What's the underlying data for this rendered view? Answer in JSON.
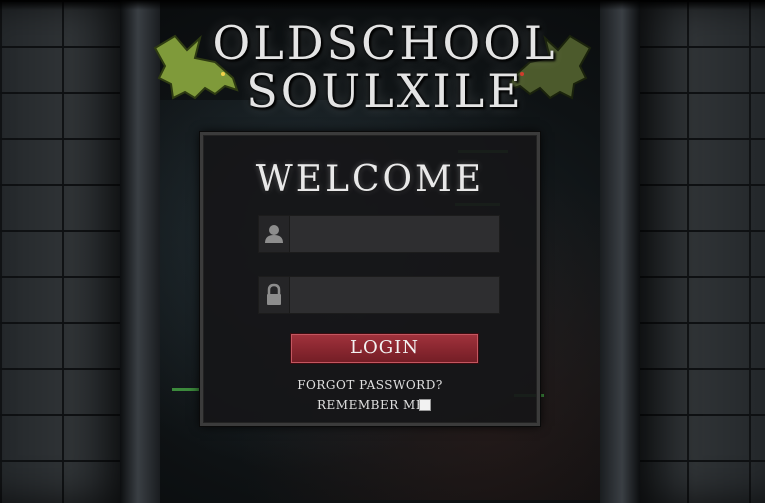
{
  "logo": {
    "line1": "OLDSCHOOL",
    "line2": "SOULXILE"
  },
  "login_panel": {
    "heading": "WELCOME",
    "username": {
      "icon": "user-icon",
      "value": "",
      "placeholder": ""
    },
    "password": {
      "icon": "lock-icon",
      "value": "",
      "placeholder": ""
    },
    "login_label": "LOGIN",
    "forgot_label": "FORGOT PASSWORD?",
    "remember_label": "REMEMBER ME",
    "remember_checked": false
  },
  "colors": {
    "accent": "#8a2730",
    "panel": "#161618",
    "text": "#e9e9e9"
  }
}
